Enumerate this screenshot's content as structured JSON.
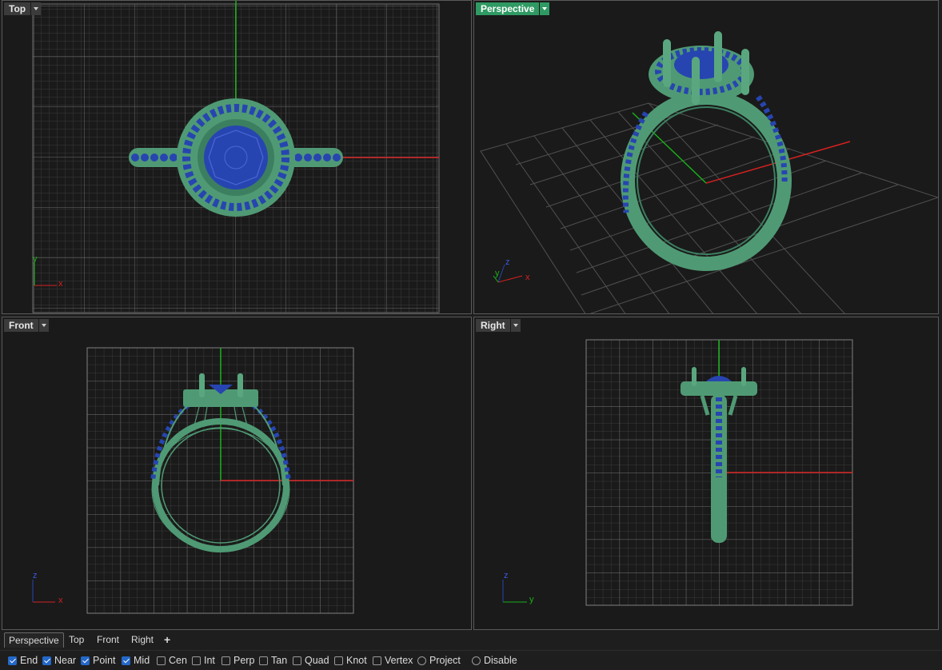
{
  "viewports": {
    "top": {
      "label": "Top"
    },
    "perspective": {
      "label": "Perspective"
    },
    "front": {
      "label": "Front"
    },
    "right": {
      "label": "Right"
    }
  },
  "axes": {
    "x": "x",
    "y": "y",
    "z": "z"
  },
  "tabs": [
    "Perspective",
    "Top",
    "Front",
    "Right"
  ],
  "add_tab": "+",
  "osnaps": [
    {
      "label": "End",
      "checked": true
    },
    {
      "label": "Near",
      "checked": true
    },
    {
      "label": "Point",
      "checked": true
    },
    {
      "label": "Mid",
      "checked": true
    },
    {
      "label": "Cen",
      "checked": false
    },
    {
      "label": "Int",
      "checked": false
    },
    {
      "label": "Perp",
      "checked": false
    },
    {
      "label": "Tan",
      "checked": false
    },
    {
      "label": "Quad",
      "checked": false
    },
    {
      "label": "Knot",
      "checked": false
    },
    {
      "label": "Vertex",
      "checked": false
    }
  ],
  "toggles": [
    {
      "label": "Project"
    },
    {
      "label": "Disable"
    }
  ],
  "colors": {
    "active_tab": "#2f9a63",
    "ring_metal": "#4f9a74",
    "gem": "#2745b0",
    "x_axis": "#d42020",
    "y_axis": "#18b018"
  }
}
